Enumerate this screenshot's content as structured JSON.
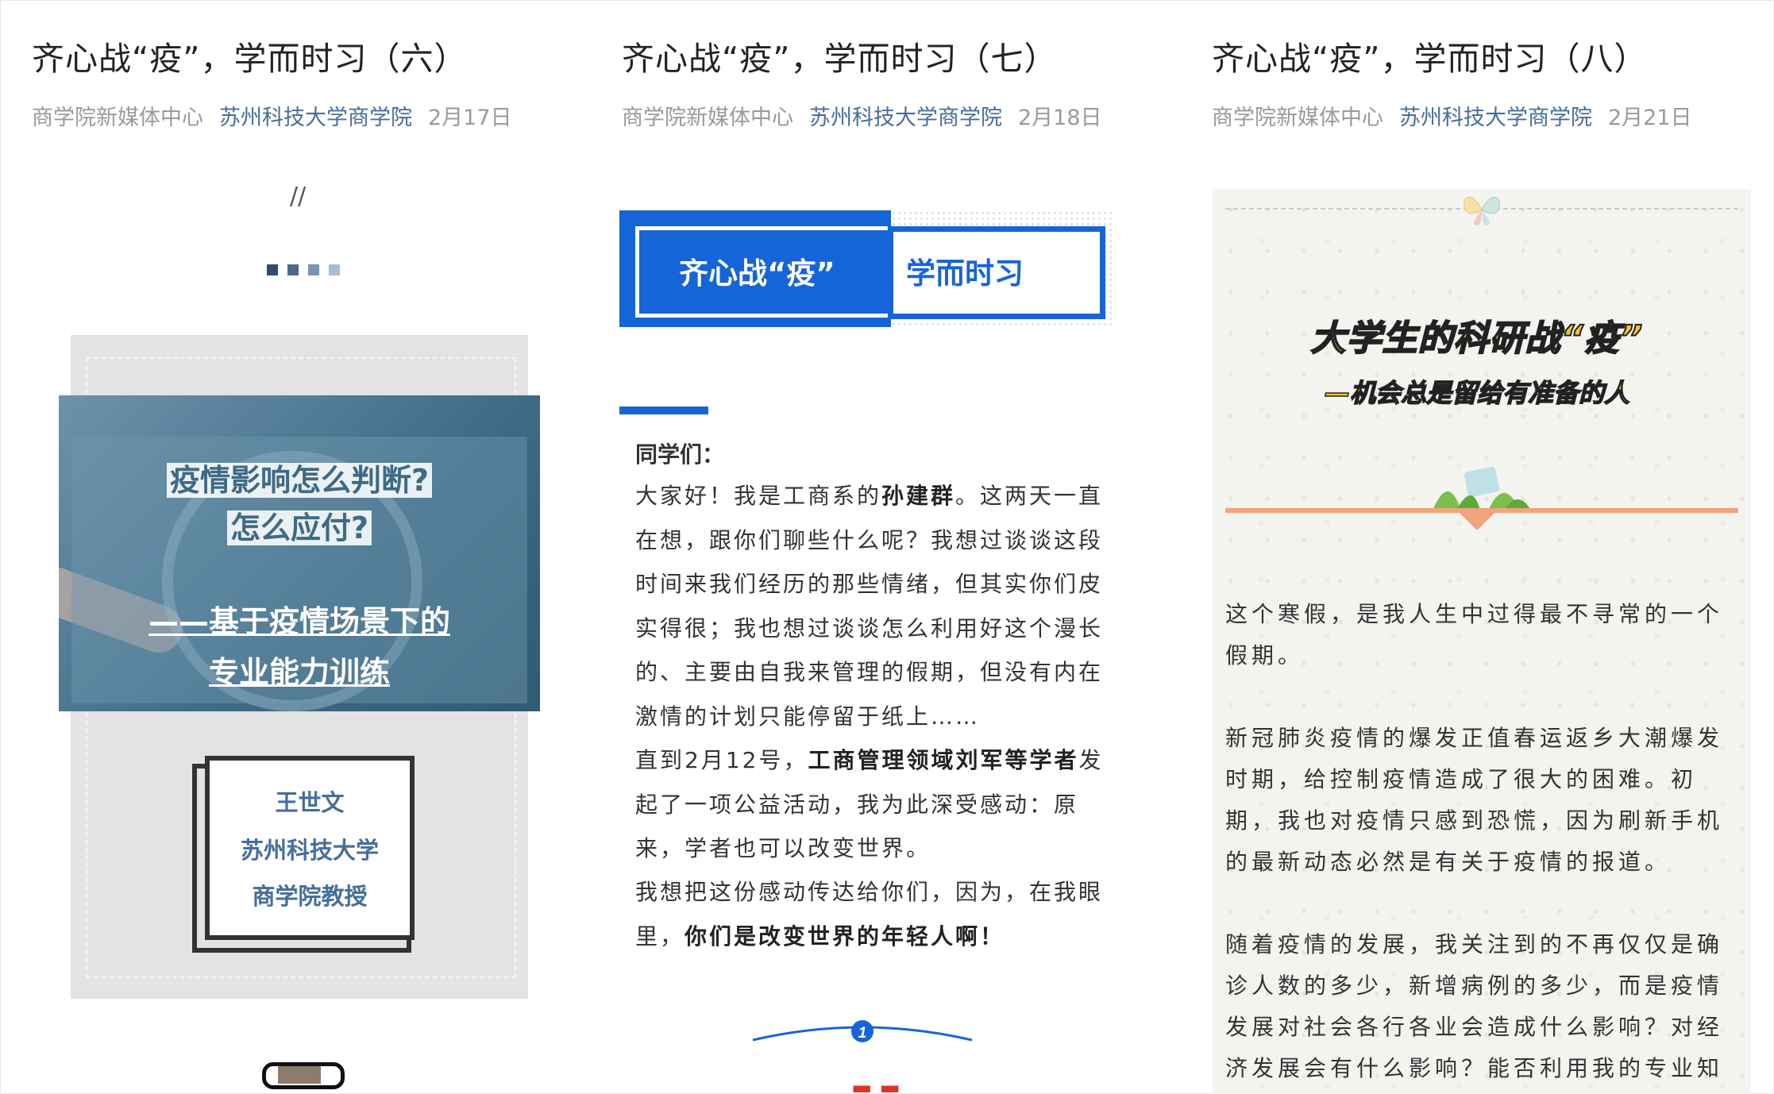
{
  "articles": [
    {
      "title": "齐心战“疫”，学而时习（六）",
      "source": "商学院新媒体中心",
      "account": "苏州科技大学商学院",
      "date": "2月17日",
      "decor": "//",
      "banner_q1": "疫情影响怎么判断?",
      "banner_q2": "怎么应付?",
      "banner_sub1": "——基于疫情场景下的",
      "banner_sub2": "专业能力训练",
      "author_name": "王世文",
      "author_org": "苏州科技大学",
      "author_title": "商学院教授",
      "colors": {
        "accent": "#466e9c",
        "square_dark": "#2f4a6e",
        "square_light": "#9fb6cc"
      }
    },
    {
      "title": "齐心战“疫”，学而时习（七）",
      "source": "商学院新媒体中心",
      "account": "苏州科技大学商学院",
      "date": "2月18日",
      "header_left": "齐心战“疫”",
      "header_right": "学而时习",
      "greeting": "同学们：",
      "p1_a": "大家好！我是工商系的",
      "p1_b": "孙建群",
      "p1_c": "。这两天一直在想，跟你们聊些什么呢？我想过谈谈这段时间来我们经历的那些情绪，但其实你们皮实得很；我也想过谈谈怎么利用好这个漫长的、主要由自我来管理的假期，但没有内在激情的计划只能停留于纸上……",
      "p2_a": "直到2月12号，",
      "p2_b": "工商管理领域刘军等学者",
      "p2_c": "发起了一项公益活动，我为此深受感动：原来，学者也可以改变世界。",
      "p3_a": "我想把这份感动传达给你们，因为，在我眼里，",
      "p3_b": "你们是改变世界的年轻人啊！",
      "section_number": "1",
      "colors": {
        "accent": "#1565d8"
      }
    },
    {
      "title": "齐心战“疫”，学而时习（八）",
      "source": "商学院新媒体中心",
      "account": "苏州科技大学商学院",
      "date": "2月21日",
      "headline": "大学生的科研战“疫”",
      "subheadline": "—机会总是留给有准备的人",
      "p1": "这个寒假，是我人生中过得最不寻常的一个假期。",
      "p2": "新冠肺炎疫情的爆发正值春运返乡大潮爆发时期，给控制疫情造成了很大的困难。初期，我也对疫情只感到恐慌，因为刷新手机的最新动态必然是有关于疫情的报道。",
      "p3": "随着疫情的发展，我关注到的不再仅仅是确诊人数的多少，新增病例的多少，而是疫情发展对社会各行各业会造成什么影响？对经济发展会有什么影响？能否利用我的专业知识做点什么？在我",
      "colors": {
        "headline_fill": "#f1c232",
        "divider": "#f2a27c"
      }
    }
  ]
}
